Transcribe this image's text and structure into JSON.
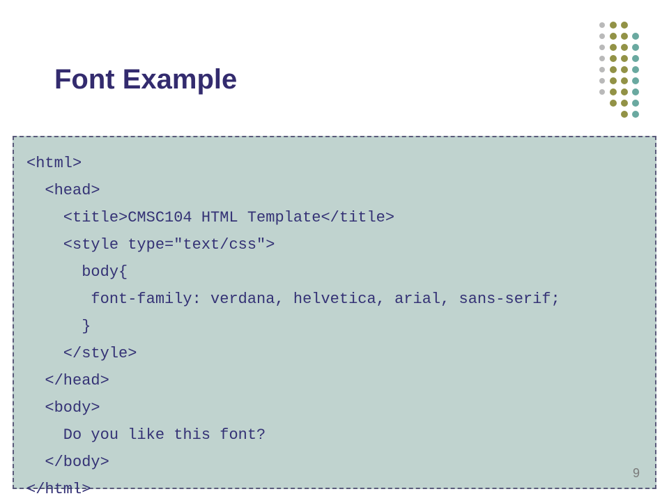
{
  "slide": {
    "title": "Font Example",
    "page_number": "9",
    "code_lines": [
      "<html>",
      "  <head>",
      "    <title>CMSC104 HTML Template</title>",
      "    <style type=\"text/css\">",
      "      body{",
      "       font-family: verdana, helvetica, arial, sans-serif;",
      "      }",
      "    </style>",
      "  </head>",
      "  <body>",
      "    Do you like this font?",
      "  </body>",
      "</html>"
    ],
    "decoration": {
      "colors": {
        "olive": "#929246",
        "teal": "#6aa9a0",
        "gray": "#b9b9b9"
      }
    }
  }
}
